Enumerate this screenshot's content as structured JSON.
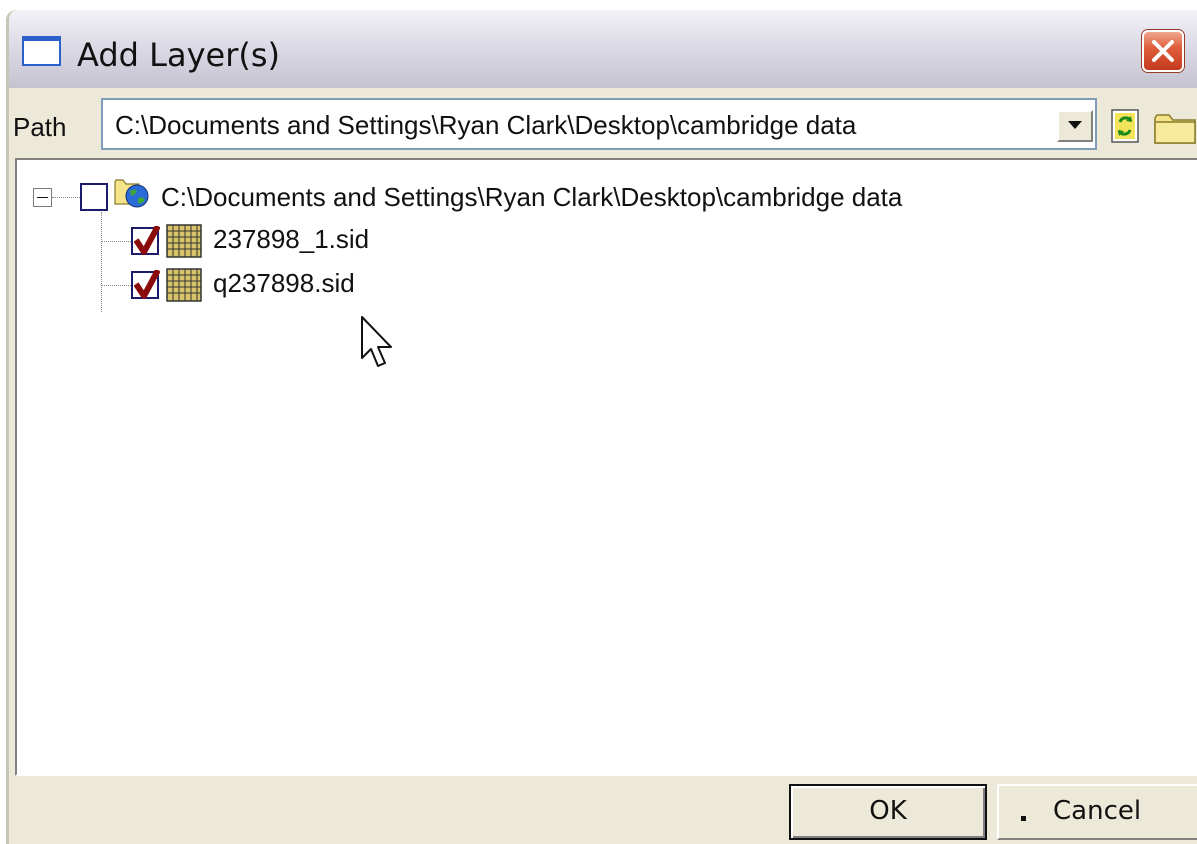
{
  "window": {
    "title": "Add Layer(s)"
  },
  "path_bar": {
    "label": "Path",
    "value": "C:\\Documents and Settings\\Ryan Clark\\Desktop\\cambridge data"
  },
  "tree": {
    "root": {
      "label": "C:\\Documents and Settings\\Ryan Clark\\Desktop\\cambridge data",
      "checked": false,
      "expanded": true
    },
    "items": [
      {
        "label": "237898_1.sid",
        "checked": true
      },
      {
        "label": "q237898.sid",
        "checked": true
      }
    ]
  },
  "buttons": {
    "ok": "OK",
    "cancel": "Cancel"
  },
  "colors": {
    "check_mark": "#8b0a0a",
    "close_button": "#d9532e",
    "panel_bg": "#ece9d8"
  },
  "icons": {
    "title": "window-icon",
    "close": "close-icon",
    "dropdown": "chevron-down-icon",
    "refresh": "refresh-icon",
    "open_folder": "folder-icon",
    "root_node": "globe-folder-icon",
    "layer": "raster-layer-icon",
    "pointer": "mouse-cursor-icon"
  }
}
